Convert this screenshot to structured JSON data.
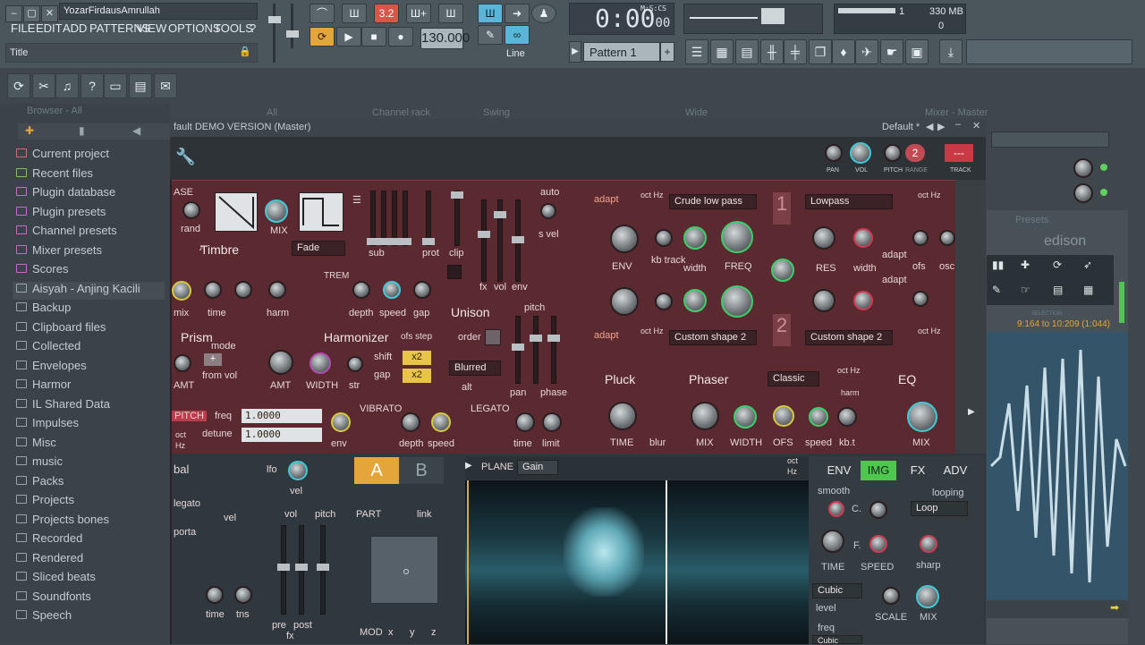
{
  "window": {
    "title": "YozarFirdausAmrullah",
    "hint": "Title"
  },
  "menu": [
    "FILE",
    "EDIT",
    "ADD",
    "PATTERNS",
    "VIEW",
    "OPTIONS",
    "TOOLS",
    "?"
  ],
  "transport": {
    "bpm": "130.000",
    "time": "0:00",
    "time_sub": "00",
    "time_unit": "M:S:CS",
    "snap": "Line",
    "pattern": "Pattern 1",
    "cpu_poly": "1",
    "cpu_mem": "330 MB",
    "cpu_val": "0"
  },
  "browser": {
    "header": "Browser - All",
    "items": [
      {
        "label": "Current project",
        "color": "#c8736f"
      },
      {
        "label": "Recent files",
        "color": "#7fbf6a"
      },
      {
        "label": "Plugin database",
        "color": "#c96ac9"
      },
      {
        "label": "Plugin presets",
        "color": "#c96ac9"
      },
      {
        "label": "Channel presets",
        "color": "#c96ac9"
      },
      {
        "label": "Mixer presets",
        "color": "#c96ac9"
      },
      {
        "label": "Scores",
        "color": "#c96ac9"
      },
      {
        "label": "Aisyah - Anjing Kacili",
        "color": "#9aa5ab"
      },
      {
        "label": "Backup",
        "color": "#9aa5ab"
      },
      {
        "label": "Clipboard files",
        "color": "#9aa5ab"
      },
      {
        "label": "Collected",
        "color": "#9aa5ab"
      },
      {
        "label": "Envelopes",
        "color": "#9aa5ab"
      },
      {
        "label": "Harmor",
        "color": "#9aa5ab"
      },
      {
        "label": "IL Shared Data",
        "color": "#9aa5ab"
      },
      {
        "label": "Impulses",
        "color": "#9aa5ab"
      },
      {
        "label": "Misc",
        "color": "#9aa5ab"
      },
      {
        "label": "music",
        "color": "#9aa5ab"
      },
      {
        "label": "Packs",
        "color": "#9aa5ab"
      },
      {
        "label": "Projects",
        "color": "#9aa5ab"
      },
      {
        "label": "Projects bones",
        "color": "#9aa5ab"
      },
      {
        "label": "Recorded",
        "color": "#9aa5ab"
      },
      {
        "label": "Rendered",
        "color": "#9aa5ab"
      },
      {
        "label": "Sliced beats",
        "color": "#9aa5ab"
      },
      {
        "label": "Soundfonts",
        "color": "#9aa5ab"
      },
      {
        "label": "Speech",
        "color": "#9aa5ab"
      }
    ]
  },
  "plugin": {
    "title": "fault DEMO VERSION (Master)",
    "preset": "Default *",
    "track": "2",
    "labels": {
      "pan": "PAN",
      "vol": "VOL",
      "pitch": "PITCH",
      "range": "RANGE",
      "track": "TRACK"
    },
    "synth": {
      "base": "ASE",
      "rand": "rand",
      "mix": "MIX",
      "timbre": "Timbre",
      "fade": "Fade",
      "sub": "sub",
      "prot": "prot",
      "clip": "clip",
      "fx": "fx",
      "vol": "vol",
      "env": "env",
      "auto": "auto",
      "svel": "s vel",
      "mix2": "mix",
      "time": "time",
      "harm": "harm",
      "trem": "TREM",
      "depth": "depth",
      "speed": "speed",
      "gap": "gap",
      "unison": "Unison",
      "order": "order",
      "pitch": "pitch",
      "prism": "Prism",
      "mode": "mode",
      "fromvol": "from vol",
      "amt": "AMT",
      "harmonizer": "Harmonizer",
      "ofsstep": "ofs step",
      "amt2": "AMT",
      "width": "WIDTH",
      "str": "str",
      "shift": "shift",
      "gap2": "gap",
      "x2": "x2",
      "blurred": "Blurred",
      "alt": "alt",
      "pan": "pan",
      "phase": "phase",
      "pitch2": "PITCH",
      "freq": "freq",
      "detune": "detune",
      "vibrato": "VIBRATO",
      "legato": "LEGATO",
      "freqval": "1.0000",
      "detuneval": "1.0000",
      "oct": "oct",
      "hz": "Hz",
      "depth2": "depth",
      "speed2": "speed",
      "env2": "env",
      "time2": "time",
      "limit": "limit",
      "adapt": "adapt",
      "filter1": "Crude low pass",
      "filter2": "Lowpass",
      "filter3": "Custom shape 2",
      "filter4": "Custom shape 2",
      "envk": "ENV",
      "kbtrack": "kb track",
      "width2": "width",
      "freqk": "FREQ",
      "res": "RES",
      "width3": "width",
      "ofs": "ofs",
      "osc": "osc",
      "f1": "1",
      "f2": "2",
      "pluck": "Pluck",
      "phaser": "Phaser",
      "classic": "Classic",
      "eq": "EQ",
      "timek": "TIME",
      "blur": "blur",
      "mixk": "MIX",
      "widthk": "WIDTH",
      "ofsk": "OFS",
      "speedk": "speed",
      "kbt": "kb.t",
      "mixeq": "MIX",
      "harm2": "harm",
      "octhz": "oct Hz"
    },
    "lower": {
      "bal": "bal",
      "lfo": "lfo",
      "vel": "vel",
      "legato": "legato",
      "vel2": "vel",
      "porta": "porta",
      "vol": "vol",
      "pitch": "pitch",
      "time": "time",
      "tns": "tns",
      "pre": "pre",
      "post": "post",
      "fx": "fx",
      "a": "A",
      "b": "B",
      "part": "PART",
      "link": "link",
      "mod": "MOD",
      "x": "x",
      "y": "y",
      "z": "z",
      "plane": "PLANE",
      "gain": "Gain",
      "oct": "oct",
      "hz": "Hz"
    },
    "env": {
      "tabs": [
        "ENV",
        "IMG",
        "FX",
        "ADV"
      ],
      "active": "IMG",
      "smooth": "smooth",
      "c": "C.",
      "looping": "looping",
      "loop": "Loop",
      "f": "F.",
      "time": "TIME",
      "speed": "SPEED",
      "sharp": "sharp",
      "cubic": "Cubic",
      "level": "level",
      "scale": "SCALE",
      "mix": "MIX",
      "freq": "freq",
      "cubic2": "Cubic"
    }
  },
  "edison": {
    "presets": "Presets",
    "logo": "edison",
    "selection": "9:164 to 10:209 (1:044)",
    "selection_label": "SELECTION"
  },
  "docks": {
    "channelrack": "Channel rack",
    "all": "All",
    "swing": "Swing",
    "wide": "Wide",
    "mixer": "Mixer - Master"
  }
}
